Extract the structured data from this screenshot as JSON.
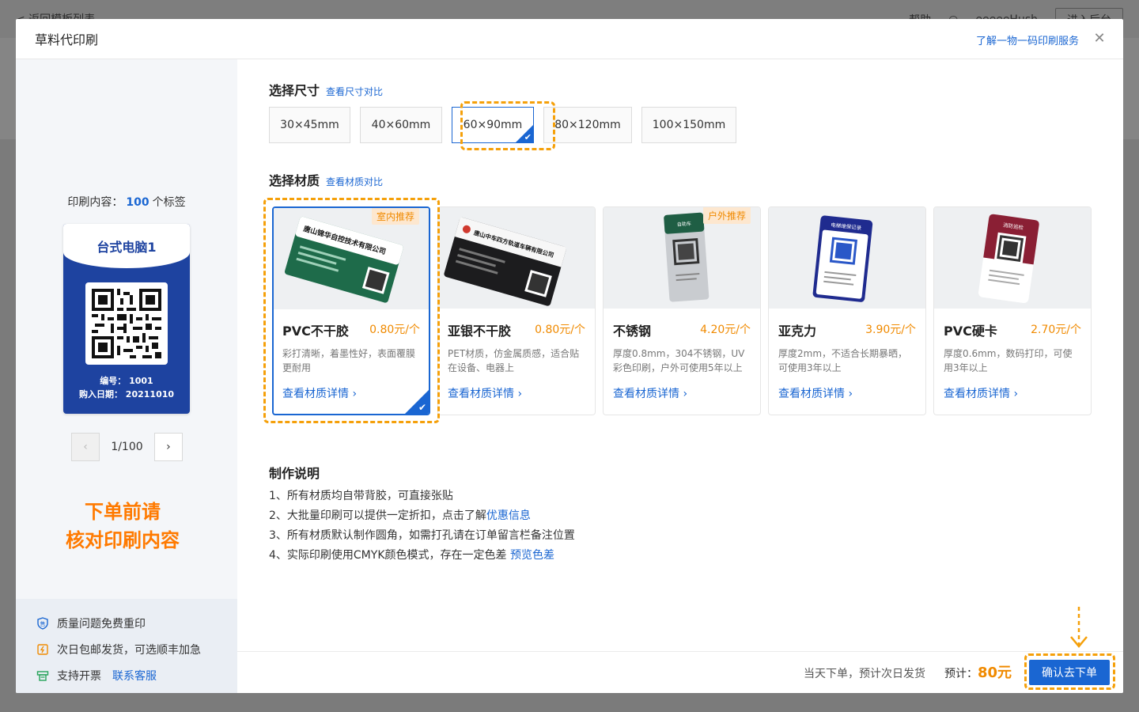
{
  "background": {
    "back_link": "< 返回模板列表",
    "help": "帮助",
    "user": "eeeeeHush",
    "enter_backend": "进入后台"
  },
  "modal": {
    "title": "草料代印刷",
    "service_link": "了解一物一码印刷服务"
  },
  "left": {
    "print_prefix": "印刷内容：",
    "print_count": "100",
    "print_suffix": "个标签",
    "label": {
      "title": "台式电脑1",
      "code_line": "编号： 1001",
      "date_line": "购入日期： 20211010"
    },
    "pager": {
      "text": "1/100"
    },
    "warning_line1": "下单前请",
    "warning_line2": "核对印刷内容",
    "guarantees": [
      {
        "text": "质量问题免费重印",
        "icon": "shield-icon"
      },
      {
        "text": "次日包邮发货，可选顺丰加急",
        "icon": "delivery-icon"
      },
      {
        "text": "支持开票",
        "icon": "invoice-icon",
        "link": "联系客服"
      }
    ]
  },
  "size": {
    "title": "选择尺寸",
    "compare_link": "查看尺寸对比",
    "options": [
      "30×45mm",
      "40×60mm",
      "60×90mm",
      "80×120mm",
      "100×150mm"
    ],
    "selected": "60×90mm"
  },
  "material": {
    "title": "选择材质",
    "compare_link": "查看材质对比",
    "detail_link": "查看材质详情 ›",
    "items": [
      {
        "name": "PVC不干胶",
        "price": "0.80元/个",
        "badge": "室内推荐",
        "desc": "彩打清晰，着墨性好，表面覆膜更耐用",
        "selected": true,
        "img_text": "唐山锦华自控技术有限公司"
      },
      {
        "name": "亚银不干胶",
        "price": "0.80元/个",
        "badge": "",
        "desc": "PET材质，仿金属质感，适合贴在设备、电器上",
        "selected": false,
        "img_text": "唐山中车四方轨道车辆有限公司"
      },
      {
        "name": "不锈钢",
        "price": "4.20元/个",
        "badge": "户外推荐",
        "desc": "厚度0.8mm，304不锈钢，UV彩色印刷，户外可使用5年以上",
        "selected": false,
        "img_text": "自助车"
      },
      {
        "name": "亚克力",
        "price": "3.90元/个",
        "badge": "",
        "desc": "厚度2mm，不适合长期暴晒，可使用3年以上",
        "selected": false,
        "img_text": "电梯维保记录"
      },
      {
        "name": "PVC硬卡",
        "price": "2.70元/个",
        "badge": "",
        "desc": "厚度0.6mm，数码打印，可使用3年以上",
        "selected": false,
        "img_text": "消防巡检"
      }
    ]
  },
  "notes": {
    "title": "制作说明",
    "line1": "1、所有材质均自带背胶，可直接张贴",
    "line2_prefix": "2、大批量印刷可以提供一定折扣，点击了解",
    "line2_link": "优惠信息",
    "line3": "3、所有材质默认制作圆角，如需打孔请在订单留言栏备注位置",
    "line4_prefix": "4、实际印刷使用CMYK颜色模式，存在一定色差",
    "line4_link": "预览色差"
  },
  "footer": {
    "delivery_note": "当天下单，预计次日发货",
    "total_label": "预计：",
    "total_amount": "80元",
    "confirm": "确认去下单"
  },
  "colors": {
    "primary": "#1a66d2",
    "accent_orange": "#f08a00",
    "highlight_dash": "#f5a00a",
    "label_blue": "#1e43a0"
  }
}
